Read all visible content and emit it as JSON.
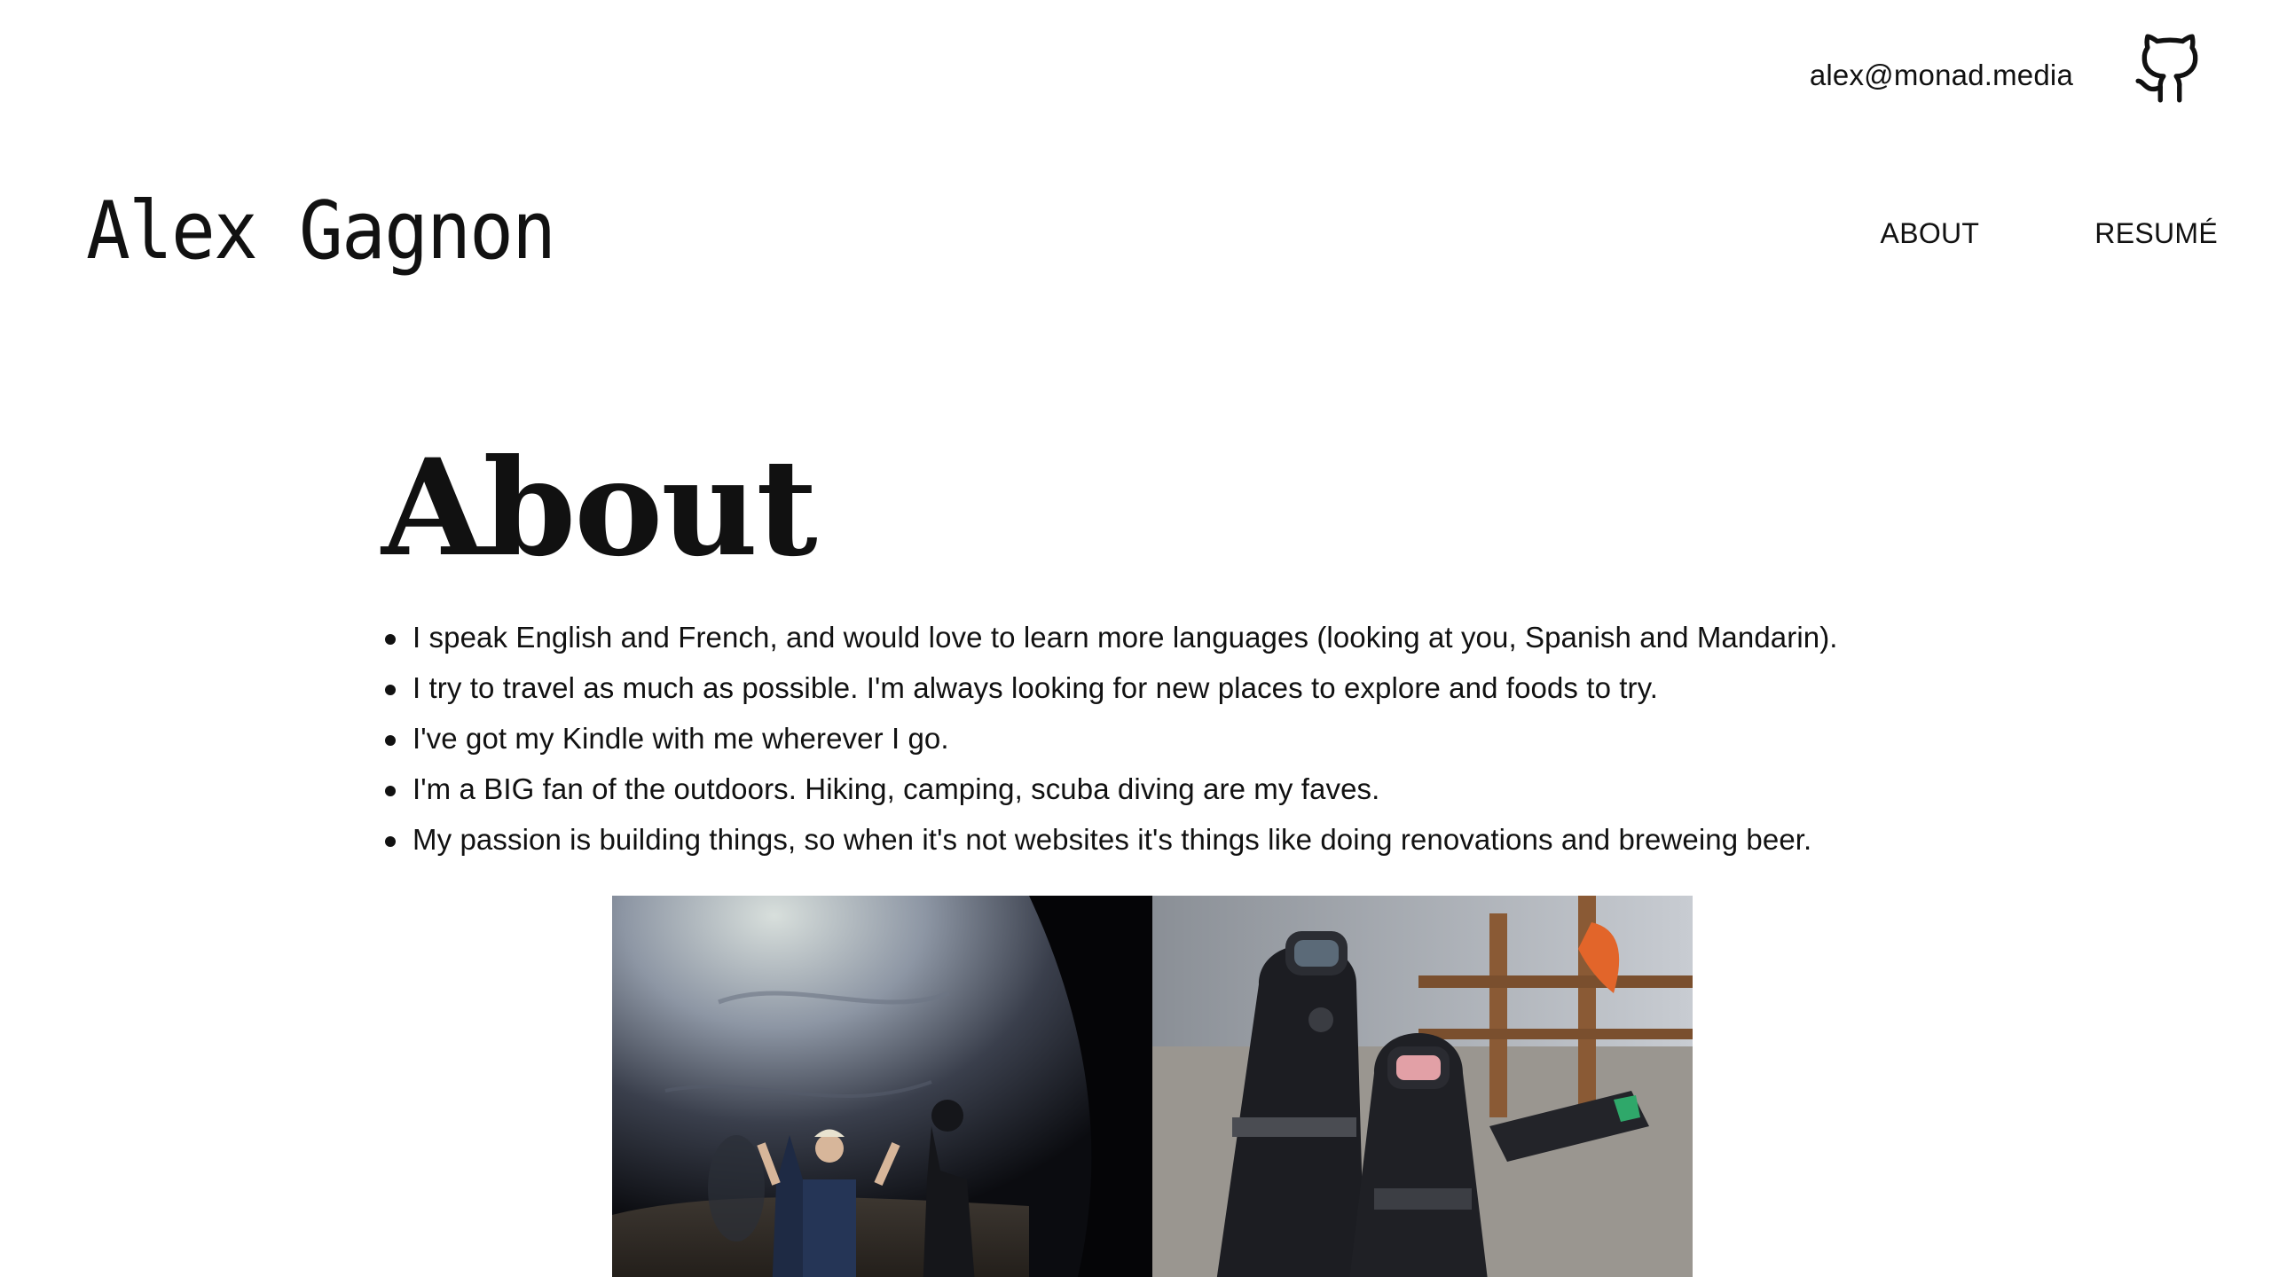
{
  "header": {
    "email": "alex@monad.media",
    "github_icon": "github-icon",
    "brand": "Alex Gagnon",
    "nav": [
      {
        "label": "ABOUT"
      },
      {
        "label": "RESUMÉ"
      }
    ]
  },
  "main": {
    "title": "About",
    "facts": [
      "I speak English and French, and would love to learn more languages (looking at you, Spanish and Mandarin).",
      "I try to travel as much as possible. I'm always looking for new places to explore and foods to try.",
      "I've got my Kindle with me wherever I go.",
      "I'm a BIG fan of the outdoors. Hiking, camping, scuba diving are my faves.",
      "My passion is building things, so when it's not websites it's things like doing renovations and breweing beer."
    ],
    "photos": [
      {
        "subject": "cave-photo"
      },
      {
        "subject": "scuba-photo"
      }
    ]
  },
  "colors": {
    "text": "#111111",
    "background": "#ffffff"
  }
}
